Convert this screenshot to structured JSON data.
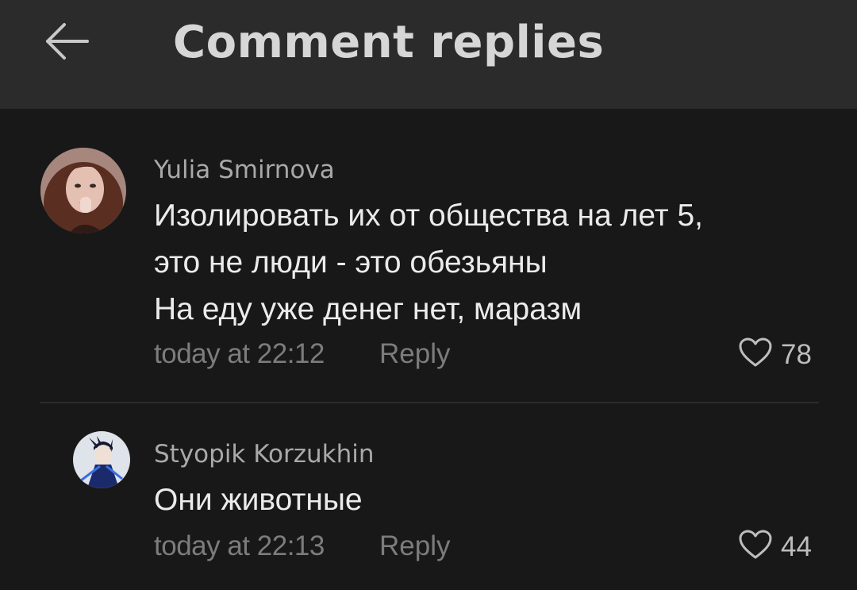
{
  "header": {
    "title": "Comment replies",
    "back_icon": "arrow-left-icon"
  },
  "comments": [
    {
      "author": "Yulia Smirnova",
      "lines": [
        "Изолировать их от общества на лет 5,",
        "это не люди - это обезьяны",
        "На еду уже денег нет, маразм"
      ],
      "time": "today at 22:12",
      "reply_label": "Reply",
      "likes": "78",
      "avatar_icon": "user-avatar-photo",
      "like_icon": "heart-icon"
    },
    {
      "author": "Styopik Korzukhin",
      "lines": [
        "Они животные"
      ],
      "time": "today at 22:13",
      "reply_label": "Reply",
      "likes": "44",
      "avatar_icon": "user-avatar-anime",
      "like_icon": "heart-icon"
    }
  ],
  "colors": {
    "background": "#181818",
    "header_background": "#2b2b2b",
    "title": "#d6d6d6",
    "author": "#a9a9a9",
    "text": "#ebebeb",
    "meta": "#7c7c7c"
  }
}
